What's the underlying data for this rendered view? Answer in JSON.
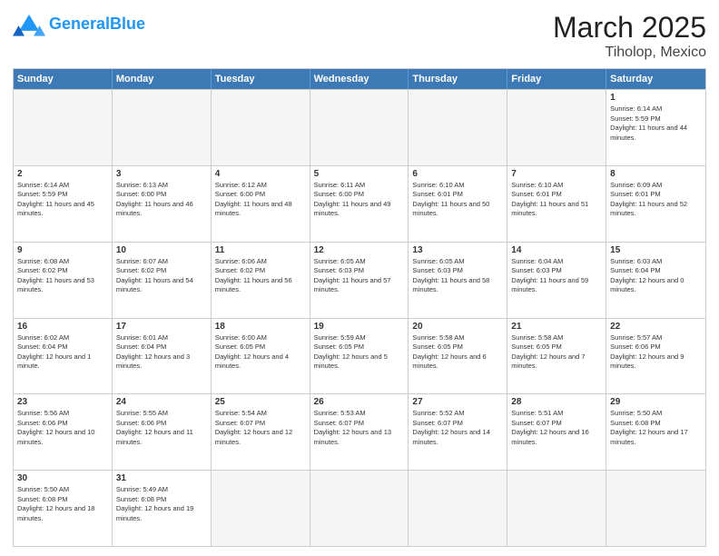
{
  "header": {
    "logo_general": "General",
    "logo_blue": "Blue",
    "title": "March 2025",
    "subtitle": "Tiholop, Mexico"
  },
  "days": [
    "Sunday",
    "Monday",
    "Tuesday",
    "Wednesday",
    "Thursday",
    "Friday",
    "Saturday"
  ],
  "weeks": [
    [
      {
        "day": "",
        "empty": true
      },
      {
        "day": "",
        "empty": true
      },
      {
        "day": "",
        "empty": true
      },
      {
        "day": "",
        "empty": true
      },
      {
        "day": "",
        "empty": true
      },
      {
        "day": "",
        "empty": true
      },
      {
        "day": "1",
        "sunrise": "Sunrise: 6:14 AM",
        "sunset": "Sunset: 5:59 PM",
        "daylight": "Daylight: 11 hours and 44 minutes."
      }
    ],
    [
      {
        "day": "2",
        "sunrise": "Sunrise: 6:14 AM",
        "sunset": "Sunset: 5:59 PM",
        "daylight": "Daylight: 11 hours and 45 minutes."
      },
      {
        "day": "3",
        "sunrise": "Sunrise: 6:13 AM",
        "sunset": "Sunset: 6:00 PM",
        "daylight": "Daylight: 11 hours and 46 minutes."
      },
      {
        "day": "4",
        "sunrise": "Sunrise: 6:12 AM",
        "sunset": "Sunset: 6:00 PM",
        "daylight": "Daylight: 11 hours and 48 minutes."
      },
      {
        "day": "5",
        "sunrise": "Sunrise: 6:11 AM",
        "sunset": "Sunset: 6:00 PM",
        "daylight": "Daylight: 11 hours and 49 minutes."
      },
      {
        "day": "6",
        "sunrise": "Sunrise: 6:10 AM",
        "sunset": "Sunset: 6:01 PM",
        "daylight": "Daylight: 11 hours and 50 minutes."
      },
      {
        "day": "7",
        "sunrise": "Sunrise: 6:10 AM",
        "sunset": "Sunset: 6:01 PM",
        "daylight": "Daylight: 11 hours and 51 minutes."
      },
      {
        "day": "8",
        "sunrise": "Sunrise: 6:09 AM",
        "sunset": "Sunset: 6:01 PM",
        "daylight": "Daylight: 11 hours and 52 minutes."
      }
    ],
    [
      {
        "day": "9",
        "sunrise": "Sunrise: 6:08 AM",
        "sunset": "Sunset: 6:02 PM",
        "daylight": "Daylight: 11 hours and 53 minutes."
      },
      {
        "day": "10",
        "sunrise": "Sunrise: 6:07 AM",
        "sunset": "Sunset: 6:02 PM",
        "daylight": "Daylight: 11 hours and 54 minutes."
      },
      {
        "day": "11",
        "sunrise": "Sunrise: 6:06 AM",
        "sunset": "Sunset: 6:02 PM",
        "daylight": "Daylight: 11 hours and 56 minutes."
      },
      {
        "day": "12",
        "sunrise": "Sunrise: 6:05 AM",
        "sunset": "Sunset: 6:03 PM",
        "daylight": "Daylight: 11 hours and 57 minutes."
      },
      {
        "day": "13",
        "sunrise": "Sunrise: 6:05 AM",
        "sunset": "Sunset: 6:03 PM",
        "daylight": "Daylight: 11 hours and 58 minutes."
      },
      {
        "day": "14",
        "sunrise": "Sunrise: 6:04 AM",
        "sunset": "Sunset: 6:03 PM",
        "daylight": "Daylight: 11 hours and 59 minutes."
      },
      {
        "day": "15",
        "sunrise": "Sunrise: 6:03 AM",
        "sunset": "Sunset: 6:04 PM",
        "daylight": "Daylight: 12 hours and 0 minutes."
      }
    ],
    [
      {
        "day": "16",
        "sunrise": "Sunrise: 6:02 AM",
        "sunset": "Sunset: 6:04 PM",
        "daylight": "Daylight: 12 hours and 1 minute."
      },
      {
        "day": "17",
        "sunrise": "Sunrise: 6:01 AM",
        "sunset": "Sunset: 6:04 PM",
        "daylight": "Daylight: 12 hours and 3 minutes."
      },
      {
        "day": "18",
        "sunrise": "Sunrise: 6:00 AM",
        "sunset": "Sunset: 6:05 PM",
        "daylight": "Daylight: 12 hours and 4 minutes."
      },
      {
        "day": "19",
        "sunrise": "Sunrise: 5:59 AM",
        "sunset": "Sunset: 6:05 PM",
        "daylight": "Daylight: 12 hours and 5 minutes."
      },
      {
        "day": "20",
        "sunrise": "Sunrise: 5:58 AM",
        "sunset": "Sunset: 6:05 PM",
        "daylight": "Daylight: 12 hours and 6 minutes."
      },
      {
        "day": "21",
        "sunrise": "Sunrise: 5:58 AM",
        "sunset": "Sunset: 6:05 PM",
        "daylight": "Daylight: 12 hours and 7 minutes."
      },
      {
        "day": "22",
        "sunrise": "Sunrise: 5:57 AM",
        "sunset": "Sunset: 6:06 PM",
        "daylight": "Daylight: 12 hours and 9 minutes."
      }
    ],
    [
      {
        "day": "23",
        "sunrise": "Sunrise: 5:56 AM",
        "sunset": "Sunset: 6:06 PM",
        "daylight": "Daylight: 12 hours and 10 minutes."
      },
      {
        "day": "24",
        "sunrise": "Sunrise: 5:55 AM",
        "sunset": "Sunset: 6:06 PM",
        "daylight": "Daylight: 12 hours and 11 minutes."
      },
      {
        "day": "25",
        "sunrise": "Sunrise: 5:54 AM",
        "sunset": "Sunset: 6:07 PM",
        "daylight": "Daylight: 12 hours and 12 minutes."
      },
      {
        "day": "26",
        "sunrise": "Sunrise: 5:53 AM",
        "sunset": "Sunset: 6:07 PM",
        "daylight": "Daylight: 12 hours and 13 minutes."
      },
      {
        "day": "27",
        "sunrise": "Sunrise: 5:52 AM",
        "sunset": "Sunset: 6:07 PM",
        "daylight": "Daylight: 12 hours and 14 minutes."
      },
      {
        "day": "28",
        "sunrise": "Sunrise: 5:51 AM",
        "sunset": "Sunset: 6:07 PM",
        "daylight": "Daylight: 12 hours and 16 minutes."
      },
      {
        "day": "29",
        "sunrise": "Sunrise: 5:50 AM",
        "sunset": "Sunset: 6:08 PM",
        "daylight": "Daylight: 12 hours and 17 minutes."
      }
    ],
    [
      {
        "day": "30",
        "sunrise": "Sunrise: 5:50 AM",
        "sunset": "Sunset: 6:08 PM",
        "daylight": "Daylight: 12 hours and 18 minutes."
      },
      {
        "day": "31",
        "sunrise": "Sunrise: 5:49 AM",
        "sunset": "Sunset: 6:08 PM",
        "daylight": "Daylight: 12 hours and 19 minutes."
      },
      {
        "day": "",
        "empty": true
      },
      {
        "day": "",
        "empty": true
      },
      {
        "day": "",
        "empty": true
      },
      {
        "day": "",
        "empty": true
      },
      {
        "day": "",
        "empty": true
      }
    ]
  ]
}
